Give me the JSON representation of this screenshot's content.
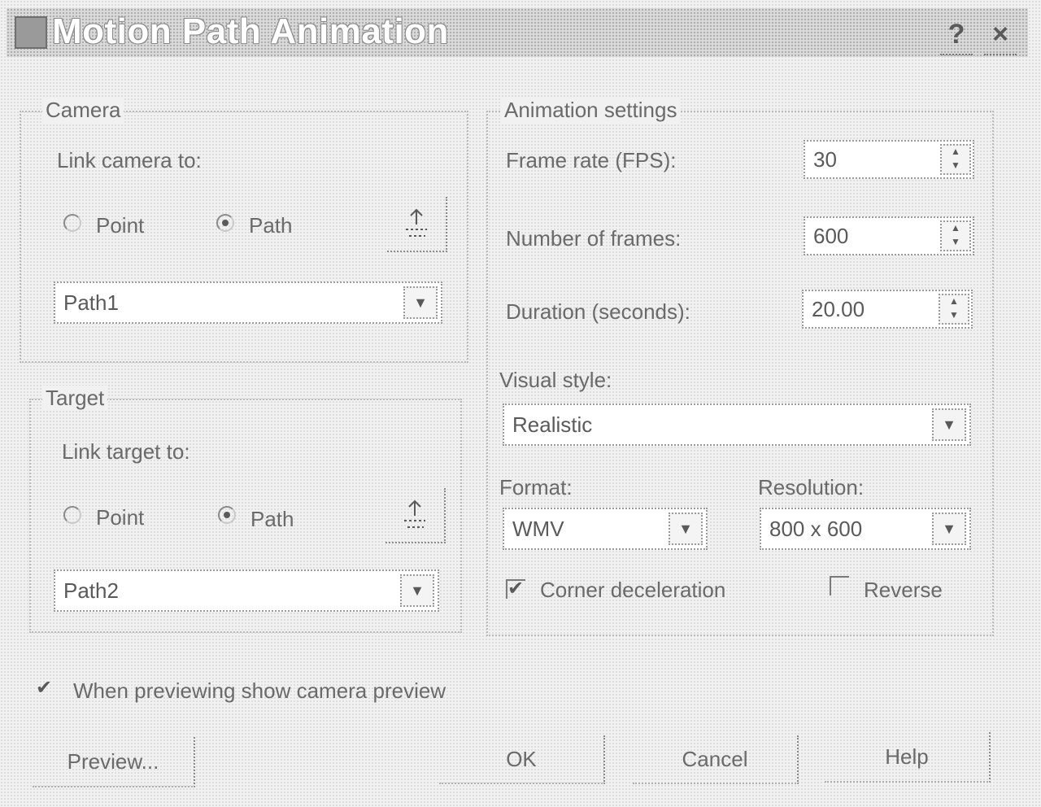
{
  "dialog": {
    "title": "Motion Path Animation",
    "help_glyph": "?",
    "close_glyph": "×"
  },
  "camera": {
    "group_label": "Camera",
    "link_label": "Link camera to:",
    "radio_point": "Point",
    "radio_path": "Path",
    "selected": "Path",
    "path_value": "Path1"
  },
  "target": {
    "group_label": "Target",
    "link_label": "Link target to:",
    "radio_point": "Point",
    "radio_path": "Path",
    "selected": "Path",
    "path_value": "Path2"
  },
  "animation": {
    "group_label": "Animation settings",
    "frame_rate_label": "Frame rate (FPS):",
    "frame_rate_value": "30",
    "frames_label": "Number of frames:",
    "frames_value": "600",
    "duration_label": "Duration (seconds):",
    "duration_value": "20.00",
    "visual_style_label": "Visual style:",
    "visual_style_value": "Realistic",
    "format_label": "Format:",
    "format_value": "WMV",
    "resolution_label": "Resolution:",
    "resolution_value": "800 x 600",
    "corner_decel_label": "Corner deceleration",
    "corner_decel_checked": true,
    "reverse_label": "Reverse",
    "reverse_checked": false
  },
  "preview_option": {
    "label": "When previewing show camera preview",
    "checked": true
  },
  "buttons": {
    "preview": "Preview...",
    "ok": "OK",
    "cancel": "Cancel",
    "help": "Help"
  }
}
